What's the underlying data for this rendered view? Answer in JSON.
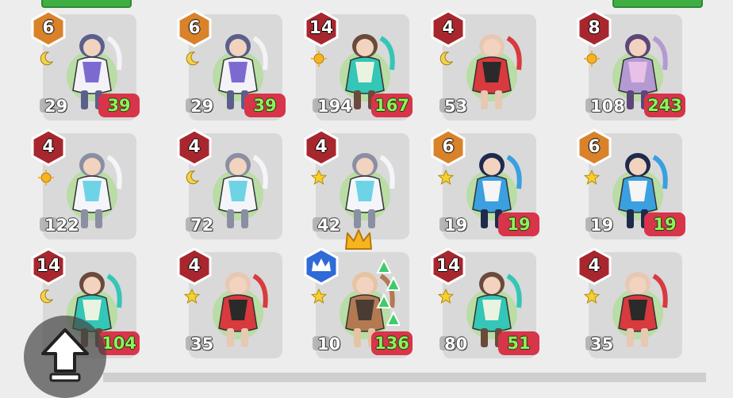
{
  "colors": {
    "tile": "#d9d9d9",
    "hex_red": "#a8262e",
    "hex_orange": "#d9822a",
    "hex_blue": "#2f6bd6",
    "count_bg": "#d8344a",
    "count_text": "#8ff15a",
    "top_button": "#3fae45"
  },
  "top_buttons": [
    {
      "name": "top-left-button"
    },
    {
      "name": "top-right-button"
    }
  ],
  "units": [
    {
      "rank": "6",
      "rank_color": "orange",
      "element": "moon",
      "level": "29",
      "count": "39",
      "palette": "silver"
    },
    {
      "rank": "6",
      "rank_color": "orange",
      "element": "moon",
      "level": "29",
      "count": "39",
      "palette": "silver"
    },
    {
      "rank": "14",
      "rank_color": "red",
      "element": "sun",
      "level": "194",
      "count": "167",
      "palette": "teal"
    },
    {
      "rank": "4",
      "rank_color": "red",
      "element": "moon",
      "level": "53",
      "count": "",
      "palette": "red"
    },
    {
      "rank": "8",
      "rank_color": "red",
      "element": "sun",
      "level": "108",
      "count": "243",
      "palette": "purple"
    },
    {
      "rank": "4",
      "rank_color": "red",
      "element": "sun",
      "level": "122",
      "count": "",
      "palette": "white"
    },
    {
      "rank": "4",
      "rank_color": "red",
      "element": "moon",
      "level": "72",
      "count": "",
      "palette": "white"
    },
    {
      "rank": "4",
      "rank_color": "red",
      "element": "star",
      "level": "42",
      "count": "",
      "palette": "white"
    },
    {
      "rank": "6",
      "rank_color": "orange",
      "element": "star",
      "level": "19",
      "count": "19",
      "palette": "blue"
    },
    {
      "rank": "6",
      "rank_color": "orange",
      "element": "star",
      "level": "19",
      "count": "19",
      "palette": "blue"
    },
    {
      "rank": "14",
      "rank_color": "red",
      "element": "moon",
      "level": "",
      "count": "104",
      "palette": "teal"
    },
    {
      "rank": "4",
      "rank_color": "red",
      "element": "star",
      "level": "35",
      "count": "",
      "palette": "red"
    },
    {
      "rank": "",
      "rank_color": "blue",
      "element": "star",
      "level": "10",
      "count": "136",
      "palette": "brown",
      "crowned": true
    },
    {
      "rank": "14",
      "rank_color": "red",
      "element": "star",
      "level": "80",
      "count": "51",
      "palette": "teal"
    },
    {
      "rank": "4",
      "rank_color": "red",
      "element": "star",
      "level": "35",
      "count": "",
      "palette": "red"
    }
  ],
  "icons": {
    "back": "up-arrow-icon",
    "crown": "crown-icon",
    "level": "level-badge-icon"
  }
}
